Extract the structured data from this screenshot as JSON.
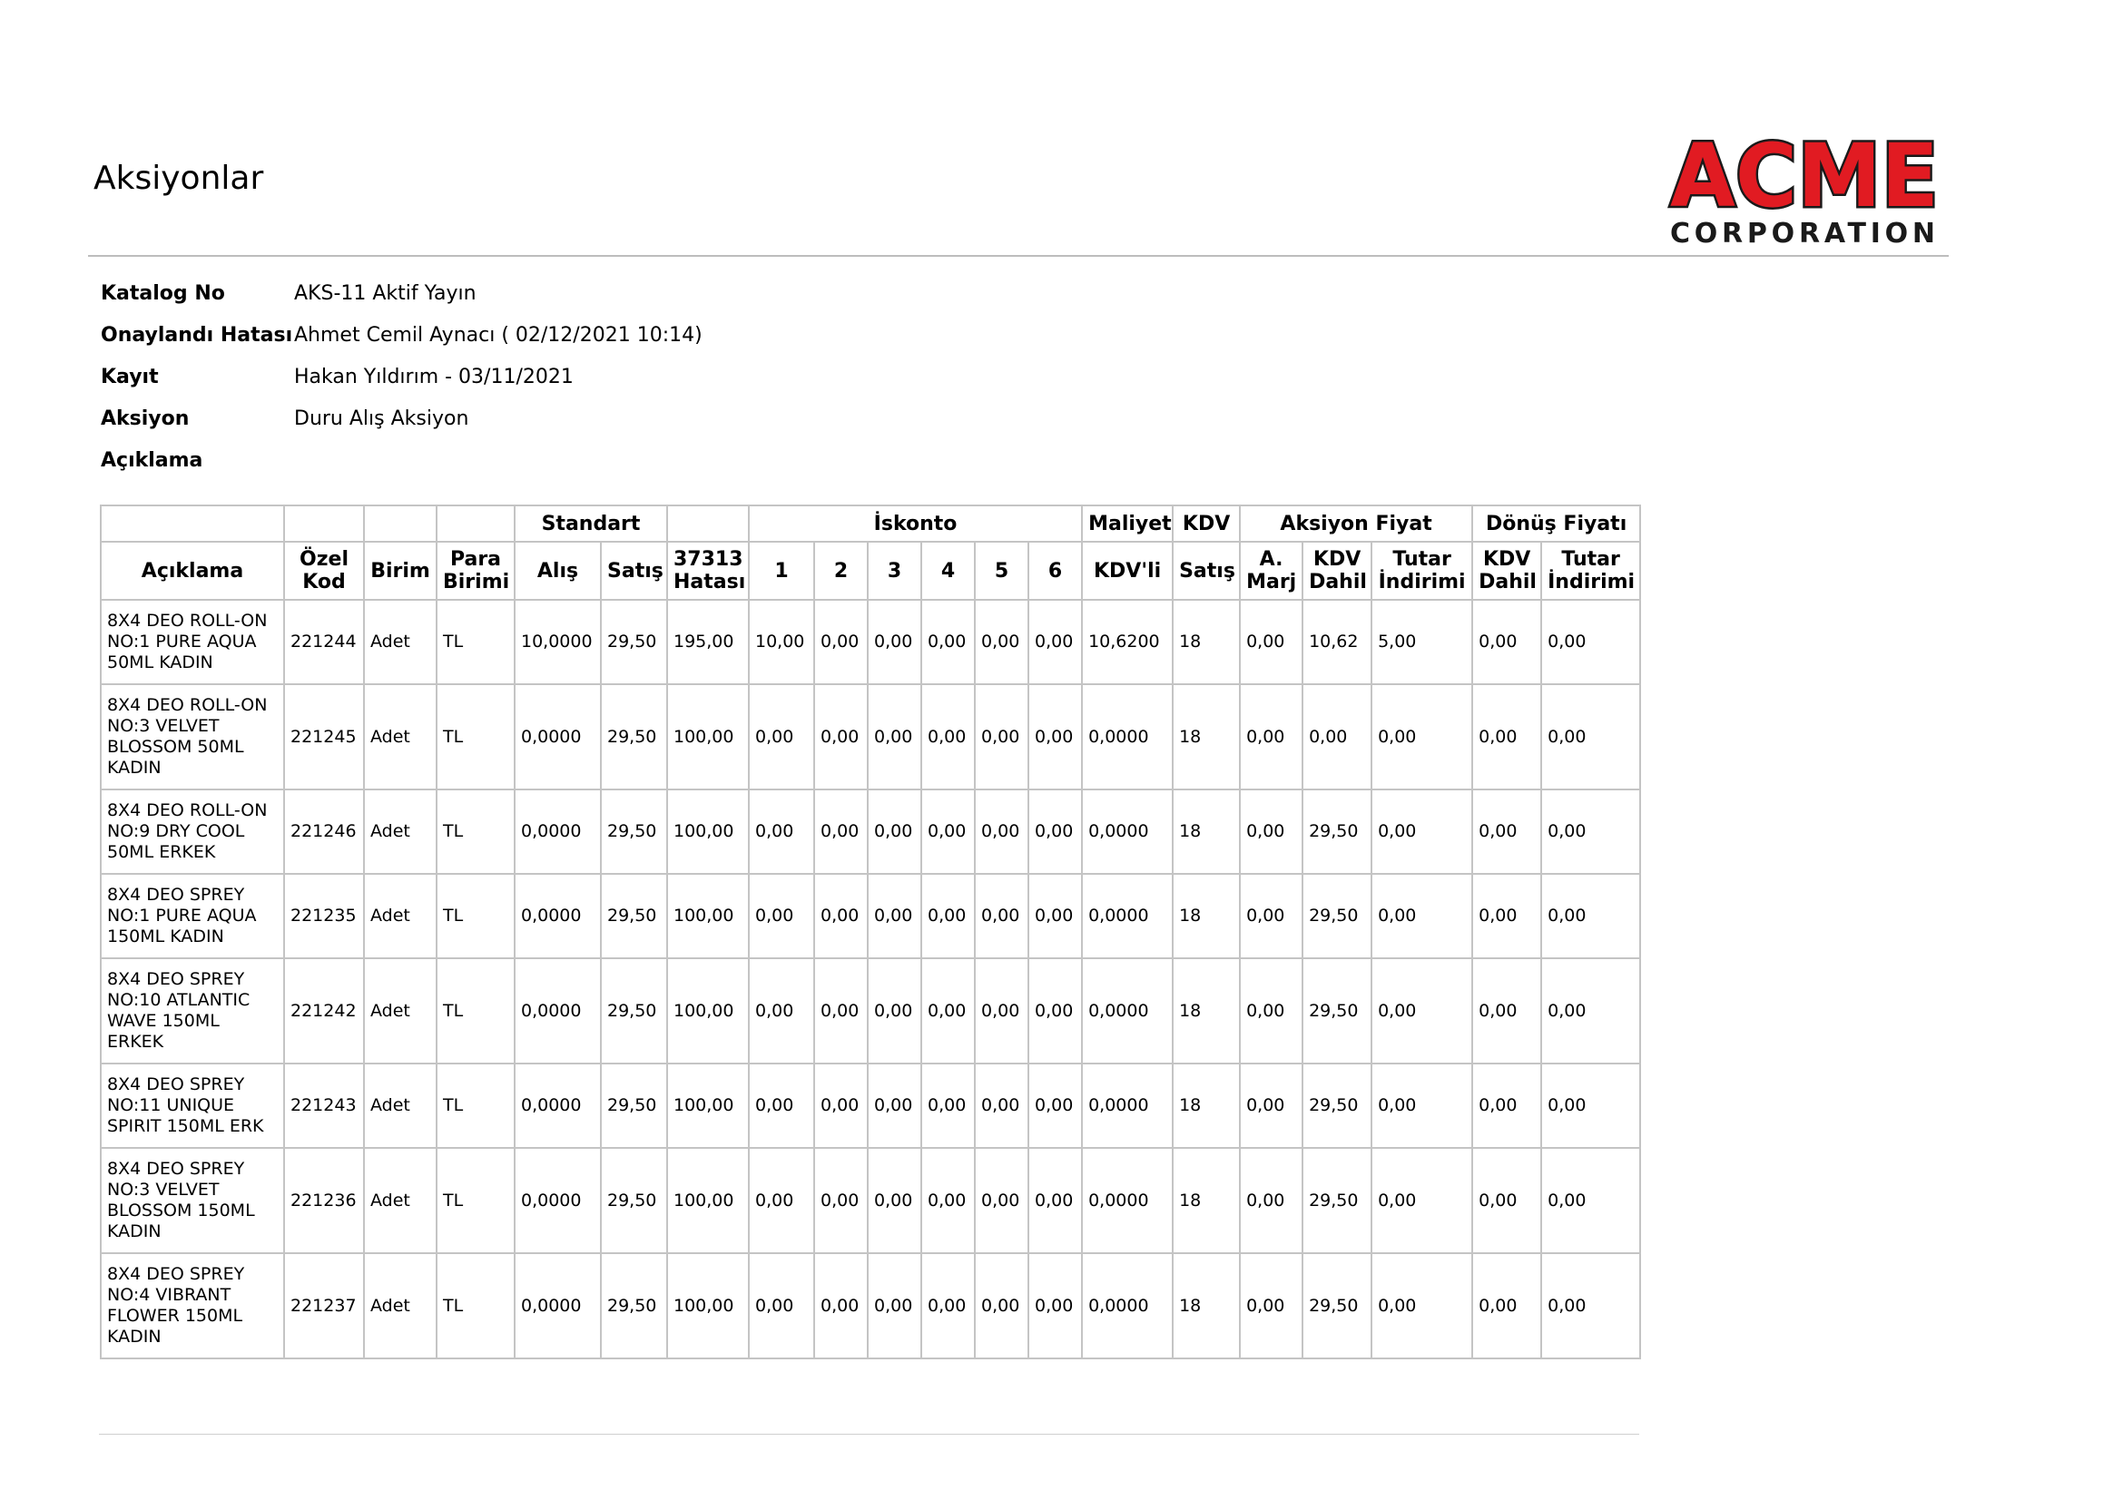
{
  "page": {
    "title": "Aksiyonlar"
  },
  "logo": {
    "line1": "ACME",
    "line2": "CORPORATION",
    "colors": {
      "red": "#e11b22",
      "dark": "#1a1a1a"
    }
  },
  "meta": {
    "fields": [
      {
        "label": "Katalog No",
        "value": "AKS-11 Aktif Yayın"
      },
      {
        "label": "Onaylandı Hatası",
        "value": "Ahmet Cemil Aynacı ( 02/12/2021 10:14)"
      },
      {
        "label": "Kayıt",
        "value": "Hakan Yıldırım - 03/11/2021"
      },
      {
        "label": "Aksiyon",
        "value": "Duru Alış Aksiyon"
      },
      {
        "label": "Açıklama",
        "value": ""
      }
    ]
  },
  "table": {
    "groups": {
      "standart": "Standart",
      "iskonto": "İskonto",
      "maliyet": "Maliyet",
      "kdv": "KDV",
      "aksiyon_fiyat": "Aksiyon Fiyat",
      "donus_fiyati": "Dönüş Fiyatı"
    },
    "headers": [
      "Açıklama",
      "Özel Kod",
      "Birim",
      "Para Birimi",
      "Alış",
      "Satış",
      "37313 Hatası",
      "1",
      "2",
      "3",
      "4",
      "5",
      "6",
      "KDV'li",
      "Satış",
      "A. Marj",
      "KDV Dahil",
      "Tutar İndirimi",
      "KDV Dahil",
      "Tutar İndirimi"
    ],
    "rows": [
      [
        "8X4 DEO ROLL-ON NO:1 PURE AQUA 50ML KADIN",
        "221244",
        "Adet",
        "TL",
        "10,0000",
        "29,50",
        "195,00",
        "10,00",
        "0,00",
        "0,00",
        "0,00",
        "0,00",
        "0,00",
        "10,6200",
        "18",
        "0,00",
        "10,62",
        "5,00",
        "0,00",
        "0,00"
      ],
      [
        "8X4 DEO ROLL-ON NO:3 VELVET BLOSSOM 50ML KADIN",
        "221245",
        "Adet",
        "TL",
        "0,0000",
        "29,50",
        "100,00",
        "0,00",
        "0,00",
        "0,00",
        "0,00",
        "0,00",
        "0,00",
        "0,0000",
        "18",
        "0,00",
        "0,00",
        "0,00",
        "0,00",
        "0,00"
      ],
      [
        "8X4 DEO ROLL-ON NO:9 DRY COOL 50ML ERKEK",
        "221246",
        "Adet",
        "TL",
        "0,0000",
        "29,50",
        "100,00",
        "0,00",
        "0,00",
        "0,00",
        "0,00",
        "0,00",
        "0,00",
        "0,0000",
        "18",
        "0,00",
        "29,50",
        "0,00",
        "0,00",
        "0,00"
      ],
      [
        "8X4 DEO SPREY NO:1 PURE AQUA 150ML KADIN",
        "221235",
        "Adet",
        "TL",
        "0,0000",
        "29,50",
        "100,00",
        "0,00",
        "0,00",
        "0,00",
        "0,00",
        "0,00",
        "0,00",
        "0,0000",
        "18",
        "0,00",
        "29,50",
        "0,00",
        "0,00",
        "0,00"
      ],
      [
        "8X4 DEO SPREY NO:10 ATLANTIC WAVE 150ML ERKEK",
        "221242",
        "Adet",
        "TL",
        "0,0000",
        "29,50",
        "100,00",
        "0,00",
        "0,00",
        "0,00",
        "0,00",
        "0,00",
        "0,00",
        "0,0000",
        "18",
        "0,00",
        "29,50",
        "0,00",
        "0,00",
        "0,00"
      ],
      [
        "8X4 DEO SPREY NO:11 UNIQUE SPIRIT 150ML ERK",
        "221243",
        "Adet",
        "TL",
        "0,0000",
        "29,50",
        "100,00",
        "0,00",
        "0,00",
        "0,00",
        "0,00",
        "0,00",
        "0,00",
        "0,0000",
        "18",
        "0,00",
        "29,50",
        "0,00",
        "0,00",
        "0,00"
      ],
      [
        "8X4 DEO SPREY NO:3 VELVET BLOSSOM 150ML KADIN",
        "221236",
        "Adet",
        "TL",
        "0,0000",
        "29,50",
        "100,00",
        "0,00",
        "0,00",
        "0,00",
        "0,00",
        "0,00",
        "0,00",
        "0,0000",
        "18",
        "0,00",
        "29,50",
        "0,00",
        "0,00",
        "0,00"
      ],
      [
        "8X4 DEO SPREY NO:4 VIBRANT FLOWER 150ML KADIN",
        "221237",
        "Adet",
        "TL",
        "0,0000",
        "29,50",
        "100,00",
        "0,00",
        "0,00",
        "0,00",
        "0,00",
        "0,00",
        "0,00",
        "0,0000",
        "18",
        "0,00",
        "29,50",
        "0,00",
        "0,00",
        "0,00"
      ]
    ]
  }
}
